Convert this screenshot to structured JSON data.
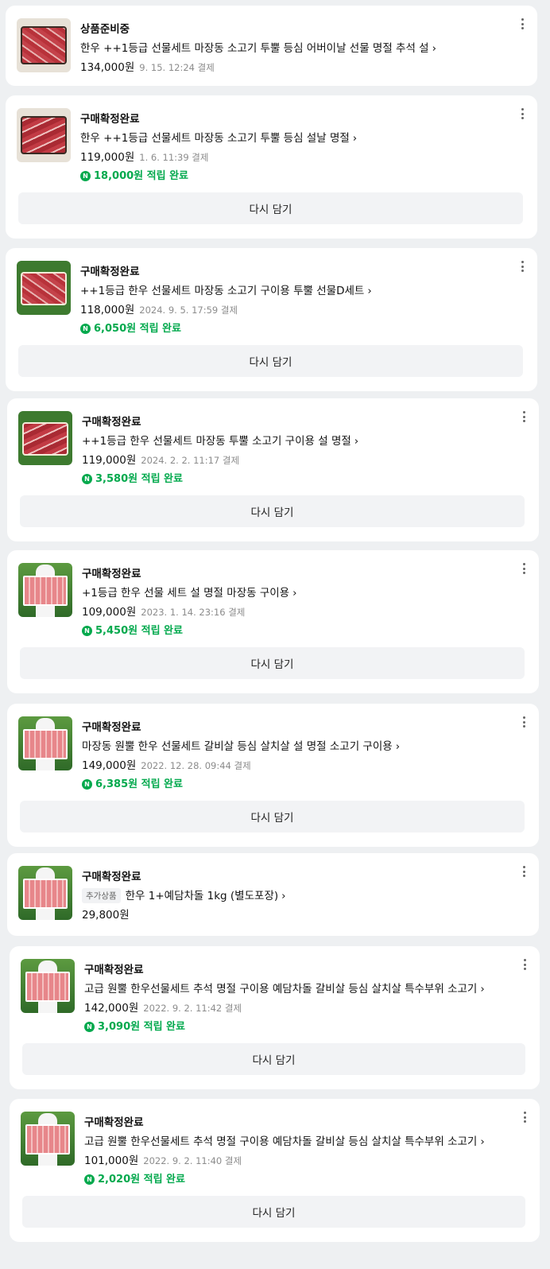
{
  "orders": [
    {
      "status": "상품준비중",
      "product": "한우 ++1등급 선물세트 마장동 소고기 투뿔 등심 어버이날 선물 명절 추석 설",
      "price": "134,000원",
      "date": "9. 15. 12:24 결제",
      "thumb_icon": "meat-gift-box-thumbnail"
    },
    {
      "status": "구매확정완료",
      "product": "한우 ++1등급 선물세트 마장동 소고기 투뿔 등심 설날 명절",
      "price": "119,000원",
      "date": "1. 6. 11:39 결제",
      "point": "18,000원 적립 완료",
      "button": "다시 담기",
      "thumb_icon": "meat-gift-box-thumbnail"
    },
    {
      "status": "구매확정완료",
      "product": "++1등급 한우 선물세트 마장동 소고기 구이용 투뿔 선물D세트",
      "price": "118,000원",
      "date": "2024. 9. 5. 17:59 결제",
      "point": "6,050원 적립 완료",
      "button": "다시 담기",
      "thumb_icon": "meat-tray-on-grass-thumbnail"
    },
    {
      "status": "구매확정완료",
      "product": "++1등급 한우 선물세트 마장동 투뿔 소고기 구이용 설 명절",
      "price": "119,000원",
      "date": "2024. 2. 2. 11:17 결제",
      "point": "3,580원 적립 완료",
      "button": "다시 담기",
      "thumb_icon": "meat-tray-on-grass-thumbnail"
    },
    {
      "status": "구매확정완료",
      "product": "+1등급 한우 선물 세트 설 명절 마장동 구이용",
      "price": "109,000원",
      "date": "2023. 1. 14. 23:16 결제",
      "point": "5,450원 적립 완료",
      "button": "다시 담기",
      "thumb_icon": "meat-pack-held-outdoors-thumbnail"
    },
    {
      "status": "구매확정완료",
      "product": "마장동 원뿔 한우 선물세트 갈비살 등심 살치살 설 명절 소고기 구이용",
      "price": "149,000원",
      "date": "2022. 12. 28. 09:44 결제",
      "point": "6,385원 적립 완료",
      "button": "다시 담기",
      "thumb_icon": "meat-pack-held-outdoors-thumbnail"
    },
    {
      "status": "구매확정완료",
      "tag": "추가상품",
      "product": "한우 1+예담차돌 1kg (별도포장)",
      "price": "29,800원",
      "thumb_icon": "meat-pack-held-outdoors-thumbnail"
    },
    {
      "status": "구매확정완료",
      "product": "고급 원뿔 한우선물세트 추석 명절 구이용 예담차돌 갈비살 등심 살치살 특수부위 소고기",
      "price": "142,000원",
      "date": "2022. 9. 2. 11:42 결제",
      "point": "3,090원 적립 완료",
      "button": "다시 담기",
      "thumb_icon": "meat-pack-held-outdoors-thumbnail"
    },
    {
      "status": "구매확정완료",
      "product": "고급 원뿔 한우선물세트 추석 명절 구이용 예담차돌 갈비살 등심 살치살 특수부위 소고기",
      "price": "101,000원",
      "date": "2022. 9. 2. 11:40 결제",
      "point": "2,020원 적립 완료",
      "button": "다시 담기",
      "thumb_icon": "meat-pack-held-outdoors-thumbnail"
    }
  ],
  "icons": {
    "chevron": "›",
    "npay_badge": "N",
    "more": "more-vertical-icon"
  },
  "colors": {
    "point_green": "#03a94d",
    "page_bg": "#eef0f2",
    "button_bg": "#f2f3f5"
  }
}
